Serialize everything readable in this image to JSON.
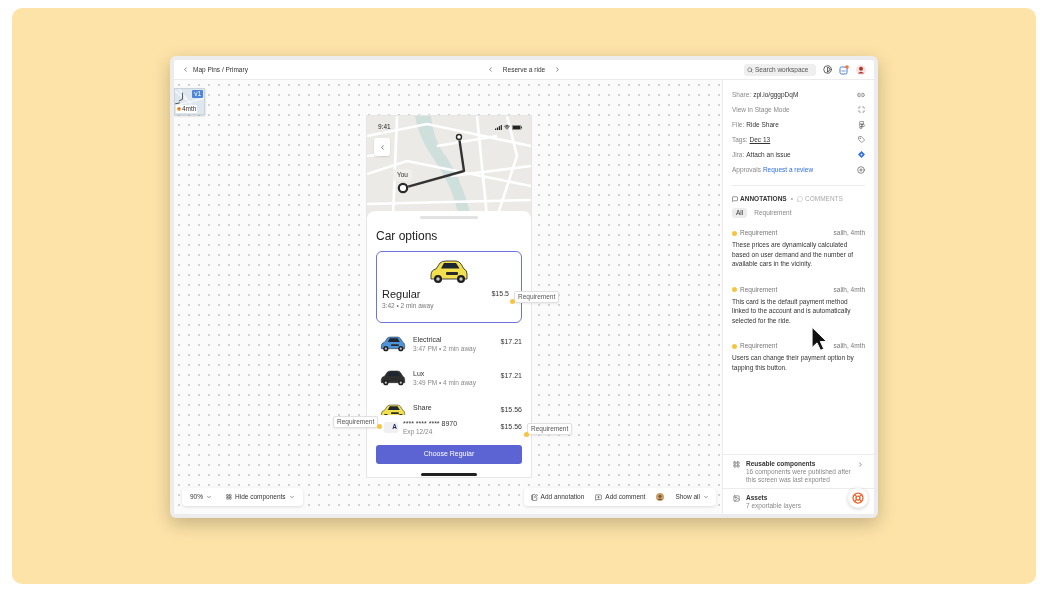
{
  "topbar": {
    "breadcrumb": "Map Pins / Primary",
    "screen_title": "Reserve a ride",
    "search": {
      "placeholder": "Search workspace"
    }
  },
  "canvas": {
    "thumbnail": {
      "badge": "v1",
      "age": "4mth"
    },
    "phone": {
      "time": "9:41",
      "map_label": "You",
      "sheet_title": "Car options",
      "options": [
        {
          "name": "Regular",
          "eta": "3:42 • 2 min away",
          "price": "$15.5",
          "color": "#f2df4e",
          "selected": true
        },
        {
          "name": "Electrical",
          "eta": "3:47 PM • 2 min away",
          "price": "$17.21",
          "color": "#4d94db",
          "selected": false
        },
        {
          "name": "Lux",
          "eta": "3:49 PM • 4 min away",
          "price": "$17.21",
          "color": "#2e2e2e",
          "selected": false
        },
        {
          "name": "Share",
          "price": "$15.56",
          "color": "#f2df4e",
          "selected": false
        }
      ],
      "payment": {
        "brand": "A",
        "number": "**** **** **** 8970",
        "expiry": "Exp 12/24",
        "price": "$15.56"
      },
      "button": "Choose Regular",
      "tags": [
        {
          "kind": "price",
          "label": "Requirement"
        },
        {
          "kind": "card",
          "label": "Requirement"
        },
        {
          "kind": "total",
          "label": "Requirement"
        }
      ]
    },
    "zoom": "90%",
    "toggle": "Hide components",
    "actions": [
      {
        "kind": "annotation",
        "label": "Add annotation"
      },
      {
        "kind": "comment",
        "label": "Add comment"
      }
    ],
    "filter": "Show all"
  },
  "panel": {
    "info": [
      {
        "kind": "share",
        "label": "Share:",
        "value": "zpl.io/gggpDqM"
      },
      {
        "kind": "stage",
        "label": "View in Stage Mode"
      },
      {
        "kind": "file",
        "label": "File:",
        "value": "Ride Share"
      },
      {
        "kind": "tags",
        "label": "Tags:",
        "value": "Dec 13"
      },
      {
        "kind": "jira",
        "label": "Jira:",
        "value": "Attach an issue"
      },
      {
        "kind": "approvals",
        "label": "Approvals",
        "value": "Request a review"
      }
    ],
    "tabs": [
      {
        "kind": "annotations",
        "label": "ANNOTATIONS",
        "selected": true
      },
      {
        "kind": "comments",
        "label": "COMMENTS",
        "selected": false
      }
    ],
    "separator": "•",
    "filters": [
      {
        "label": "All",
        "selected": true
      },
      {
        "label": "Requirement",
        "selected": false
      }
    ],
    "annotations": [
      {
        "type": "Requirement",
        "meta": "salih, 4mth",
        "text": "These prices are dynamically calculated based on user demand and the number of available cars in the vicinity."
      },
      {
        "type": "Requirement",
        "meta": "salih, 4mth",
        "text": "This card is the default payment method linked to the account and is automatically selected for the ride."
      },
      {
        "type": "Requirement",
        "meta": "salih, 4mth",
        "text": "Users can change their payment option by tapping this button."
      }
    ],
    "sections": [
      {
        "kind": "components",
        "title": "Reusable components",
        "subtitle": "16 components were published after this screen was last exported"
      },
      {
        "kind": "assets",
        "title": "Assets",
        "subtitle": "7 exportable layers"
      }
    ]
  }
}
